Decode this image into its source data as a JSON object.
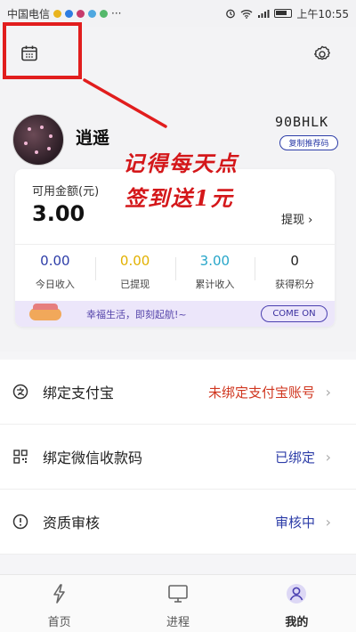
{
  "status_bar": {
    "carrier": "中国电信",
    "time": "上午10:55",
    "more": "···"
  },
  "header": {
    "username": "逍遥",
    "invite_code": "90BHLK",
    "copy_label": "复制推荐码"
  },
  "annotation": {
    "line1": "记得每天点",
    "line2": "签到送1元",
    "color": "#d4171a"
  },
  "balance": {
    "label": "可用金额(元)",
    "value": "3.00",
    "withdraw_label": "提现 ›"
  },
  "stats": [
    {
      "value": "0.00",
      "label": "今日收入",
      "color": "#2d3da8"
    },
    {
      "value": "0.00",
      "label": "已提现",
      "color": "#e2b100"
    },
    {
      "value": "3.00",
      "label": "累计收入",
      "color": "#27a6c9"
    },
    {
      "value": "0",
      "label": "获得积分",
      "color": "#222222"
    }
  ],
  "banner": {
    "text": "幸福生活，即刻起航!~",
    "button": "COME ON"
  },
  "menu": [
    {
      "label": "绑定支付宝",
      "value": "未绑定支付宝账号",
      "value_color": "#d0361f",
      "icon": "alipay-icon"
    },
    {
      "label": "绑定微信收款码",
      "value": "已绑定",
      "value_color": "#2d3da8",
      "icon": "qrcode-icon"
    },
    {
      "label": "资质审核",
      "value": "审核中",
      "value_color": "#2d3da8",
      "icon": "info-icon"
    }
  ],
  "tabs": [
    {
      "label": "首页",
      "icon": "lightning-icon"
    },
    {
      "label": "进程",
      "icon": "monitor-icon"
    },
    {
      "label": "我的",
      "icon": "person-icon"
    }
  ],
  "colors": {
    "accent": "#2d3da8",
    "highlight_box": "#e11d1d",
    "banner_bg": "#ece6fa"
  }
}
